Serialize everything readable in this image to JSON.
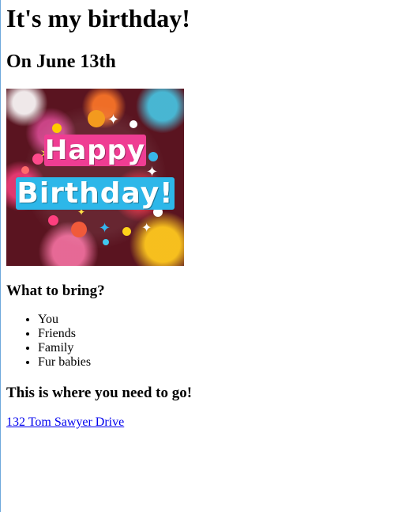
{
  "page": {
    "title": "It's my birthday!",
    "date_heading": "On June 13th",
    "image_caption": {
      "line_1": "Happy",
      "line_2": "Birthday!"
    }
  },
  "bring": {
    "heading": "What to bring?",
    "items": [
      "You",
      "Friends",
      "Family",
      "Fur babies"
    ]
  },
  "location": {
    "heading": "This is where you need to go!",
    "address": "132 Tom Sawyer Drive"
  },
  "colors": {
    "link": "#0000ee",
    "banner_background": "#5a1420"
  },
  "icons": {
    "bullet": "disc-bullet-icon",
    "image": "happy-birthday-graphic"
  }
}
